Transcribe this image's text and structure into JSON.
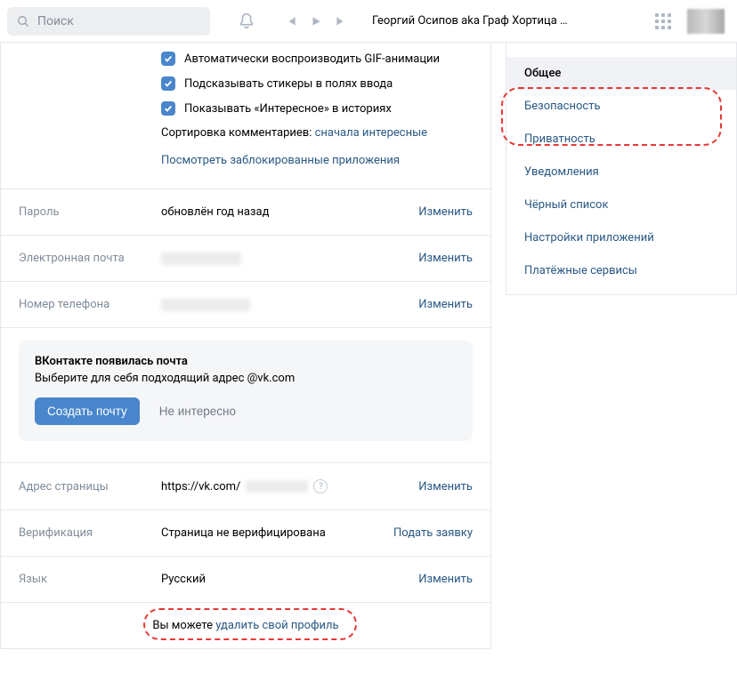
{
  "header": {
    "search_placeholder": "Поиск",
    "track": "Георгий Осипов aka Граф Хортица …"
  },
  "checks": {
    "gif": "Автоматически воспроизводить GIF-анимации",
    "stickers": "Подсказывать стикеры в полях ввода",
    "stories": "Показывать «Интересное» в историях"
  },
  "sort": {
    "label": "Сортировка комментариев: ",
    "value": "сначала интересные"
  },
  "blocked_link": "Посмотреть заблокированные приложения",
  "rows": {
    "password": {
      "key": "Пароль",
      "val": "обновлён год назад",
      "action": "Изменить"
    },
    "email": {
      "key": "Электронная почта",
      "action": "Изменить"
    },
    "phone": {
      "key": "Номер телефона",
      "action": "Изменить"
    },
    "address": {
      "key": "Адрес страницы",
      "prefix": "https://vk.com/",
      "action": "Изменить"
    },
    "verify": {
      "key": "Верификация",
      "val": "Страница не верифицирована",
      "action": "Подать заявку"
    },
    "lang": {
      "key": "Язык",
      "val": "Русский",
      "action": "Изменить"
    }
  },
  "mail": {
    "title": "ВКонтакте появилась почта",
    "desc": "Выберите для себя подходящий адрес @vk.com",
    "create": "Создать почту",
    "dismiss": "Не интересно"
  },
  "delete": {
    "prefix": "Вы можете ",
    "link": "удалить свой профиль"
  },
  "sidebar": {
    "general": "Общее",
    "security": "Безопасность",
    "privacy": "Приватность",
    "notifications": "Уведомления",
    "blacklist": "Чёрный список",
    "apps": "Настройки приложений",
    "payments": "Платёжные сервисы"
  }
}
